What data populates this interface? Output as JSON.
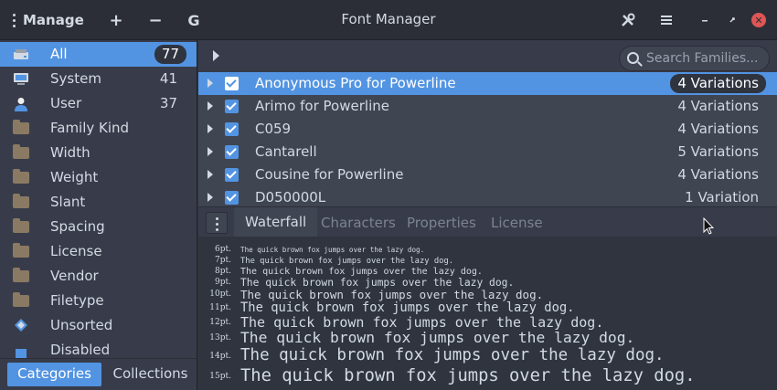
{
  "header": {
    "manage_label": "Manage",
    "add_icon": "+",
    "remove_icon": "−",
    "g_label": "G",
    "title": "Font Manager"
  },
  "sidebar": {
    "items": [
      {
        "label": "All",
        "count": "77",
        "icon": "drive-icon"
      },
      {
        "label": "System",
        "count": "41",
        "icon": "computer-icon"
      },
      {
        "label": "User",
        "count": "37",
        "icon": "user-icon"
      },
      {
        "label": "Family Kind",
        "count": "",
        "icon": "folder-icon"
      },
      {
        "label": "Width",
        "count": "",
        "icon": "folder-icon"
      },
      {
        "label": "Weight",
        "count": "",
        "icon": "folder-icon"
      },
      {
        "label": "Slant",
        "count": "",
        "icon": "folder-icon"
      },
      {
        "label": "Spacing",
        "count": "",
        "icon": "folder-icon"
      },
      {
        "label": "License",
        "count": "",
        "icon": "folder-icon"
      },
      {
        "label": "Vendor",
        "count": "",
        "icon": "folder-icon"
      },
      {
        "label": "Filetype",
        "count": "",
        "icon": "folder-icon"
      },
      {
        "label": "Unsorted",
        "count": "",
        "icon": "diamond-icon"
      },
      {
        "label": "Disabled",
        "count": "",
        "icon": "disabled-icon"
      }
    ],
    "tabs": {
      "categories": "Categories",
      "collections": "Collections"
    }
  },
  "search": {
    "placeholder": "Search Families..."
  },
  "fonts": [
    {
      "name": "Anonymous Pro for Powerline",
      "variations": "4 Variations"
    },
    {
      "name": "Arimo for Powerline",
      "variations": "4 Variations"
    },
    {
      "name": "C059",
      "variations": "4 Variations"
    },
    {
      "name": "Cantarell",
      "variations": "5 Variations"
    },
    {
      "name": "Cousine for Powerline",
      "variations": "4 Variations"
    },
    {
      "name": "D050000L",
      "variations": "1 Variation"
    }
  ],
  "preview": {
    "tabs": {
      "waterfall": "Waterfall",
      "characters": "Characters",
      "properties": "Properties",
      "license": "License"
    },
    "sample": "The quick brown fox jumps over the lazy dog.",
    "sizes": [
      "6pt.",
      "7pt.",
      "8pt.",
      "9pt.",
      "10pt.",
      "11pt.",
      "12pt.",
      "13pt.",
      "14pt.",
      "15pt."
    ]
  },
  "colors": {
    "accent": "#5294e2",
    "close": "#e05555"
  }
}
